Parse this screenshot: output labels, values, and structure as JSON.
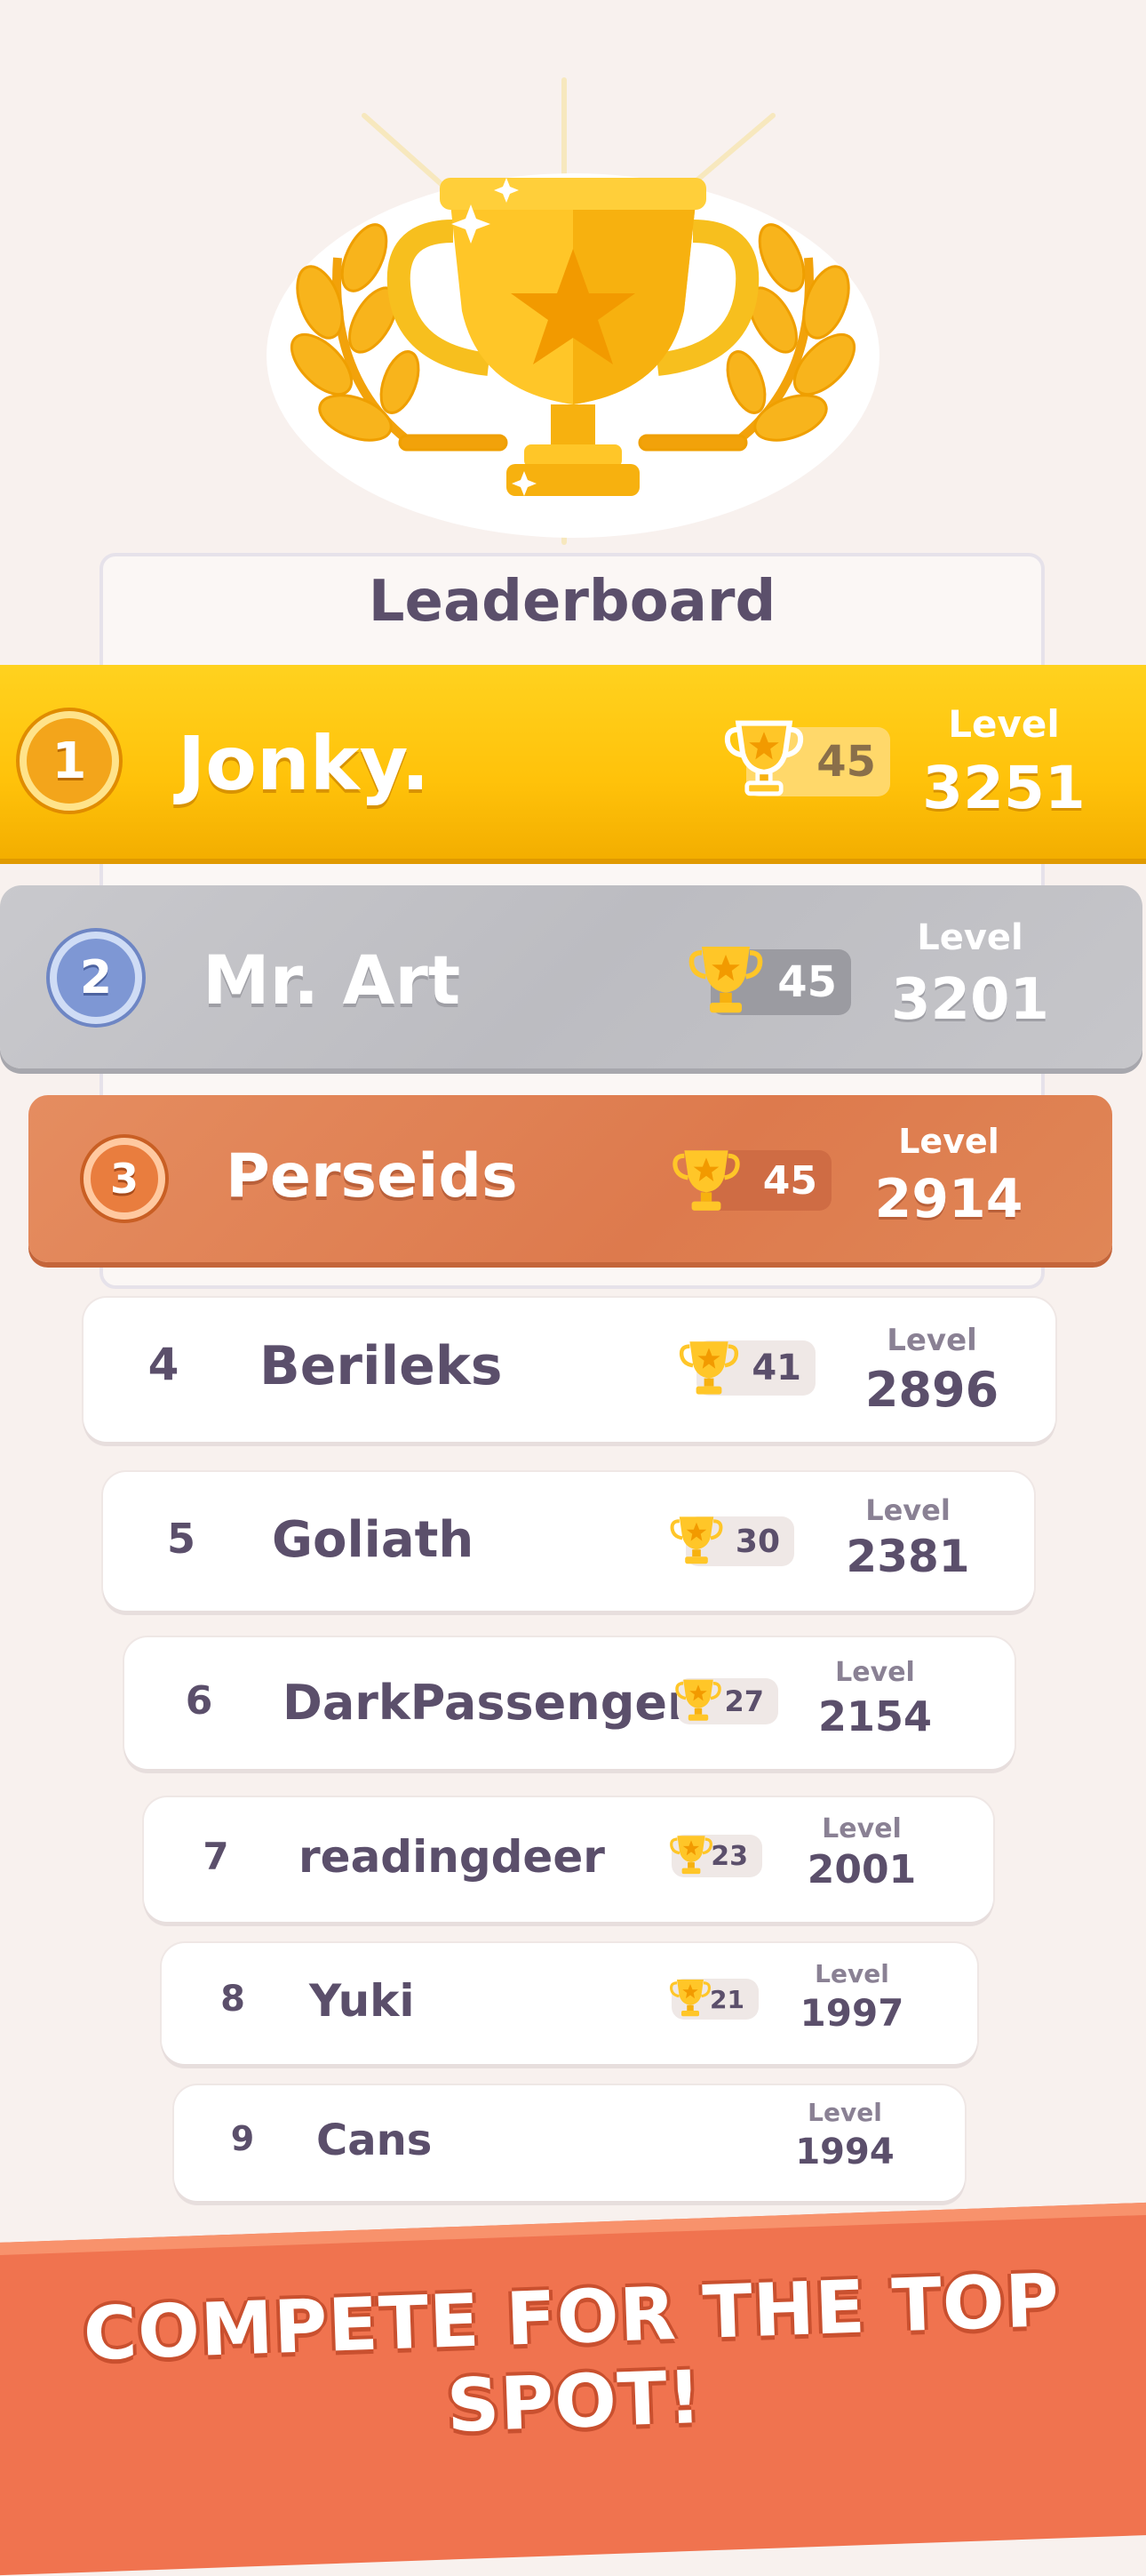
{
  "board_title": "Leaderboard",
  "level_label": "Level",
  "top_players": [
    {
      "rank": "1",
      "name": "Jonky.",
      "trophies": "45",
      "level": "3251"
    },
    {
      "rank": "2",
      "name": "Mr. Art",
      "trophies": "45",
      "level": "3201"
    },
    {
      "rank": "3",
      "name": "Perseids",
      "trophies": "45",
      "level": "2914"
    }
  ],
  "players": [
    {
      "rank": "4",
      "name": "Berileks",
      "trophies": "41",
      "level": "2896"
    },
    {
      "rank": "5",
      "name": "Goliath",
      "trophies": "30",
      "level": "2381"
    },
    {
      "rank": "6",
      "name": "DarkPassenger",
      "trophies": "27",
      "level": "2154"
    },
    {
      "rank": "7",
      "name": "readingdeer",
      "trophies": "23",
      "level": "2001"
    },
    {
      "rank": "8",
      "name": "Yuki",
      "trophies": "21",
      "level": "1997"
    },
    {
      "rank": "9",
      "name": "Cans",
      "level": "1994"
    }
  ],
  "banner_text": "COMPETE FOR THE TOP SPOT!",
  "colors": {
    "gold": "#ffc20a",
    "silver": "#c2c2c7",
    "bronze": "#e08656",
    "banner": "#f0734f",
    "text": "#5b4f6b"
  }
}
